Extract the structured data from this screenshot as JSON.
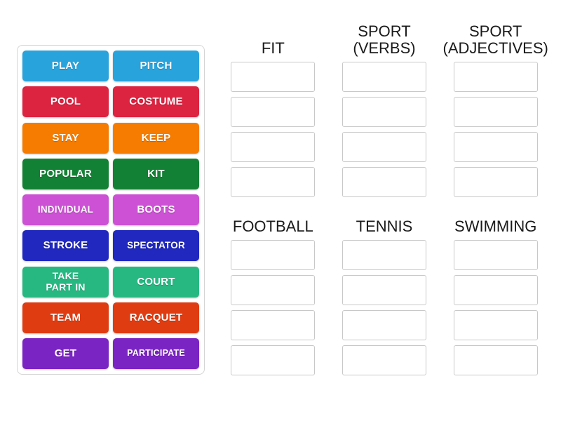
{
  "activity": {
    "type": "group-sort",
    "word_bank_label": "word-bank"
  },
  "word_bank": {
    "rows": [
      {
        "color": "#29a3dc",
        "tiles": [
          {
            "label": "PLAY"
          },
          {
            "label": "PITCH"
          }
        ]
      },
      {
        "color": "#dc2340",
        "tiles": [
          {
            "label": "POOL"
          },
          {
            "label": "COSTUME"
          }
        ]
      },
      {
        "color": "#f57c00",
        "tiles": [
          {
            "label": "STAY"
          },
          {
            "label": "KEEP"
          }
        ]
      },
      {
        "color": "#138135",
        "tiles": [
          {
            "label": "POPULAR"
          },
          {
            "label": "KIT"
          }
        ]
      },
      {
        "color": "#cc51d4",
        "tiles": [
          {
            "label": "INDIVIDUAL"
          },
          {
            "label": "BOOTS"
          }
        ]
      },
      {
        "color": "#2028c0",
        "tiles": [
          {
            "label": "STROKE"
          },
          {
            "label": "SPECTATOR"
          }
        ]
      },
      {
        "color": "#27b882",
        "tiles": [
          {
            "label": "TAKE\nPART IN"
          },
          {
            "label": "COURT"
          }
        ]
      },
      {
        "color": "#e03c12",
        "tiles": [
          {
            "label": "TEAM"
          },
          {
            "label": "RACQUET"
          }
        ]
      },
      {
        "color": "#7b24c4",
        "tiles": [
          {
            "label": "GET"
          },
          {
            "label": "PARTICIPATE"
          }
        ]
      }
    ]
  },
  "categories": {
    "slots_per_category": 4,
    "top_row": [
      {
        "title": "FIT"
      },
      {
        "title": "SPORT\n(VERBS)"
      },
      {
        "title": "SPORT\n(ADJECTIVES)"
      }
    ],
    "bottom_row": [
      {
        "title": "FOOTBALL"
      },
      {
        "title": "TENNIS"
      },
      {
        "title": "SWIMMING"
      }
    ]
  },
  "colors": {
    "panel_border": "#d5d5d5",
    "slot_border": "#c8c8c8",
    "background": "#ffffff",
    "title_text": "#1a1a1a",
    "tile_text": "#ffffff"
  }
}
